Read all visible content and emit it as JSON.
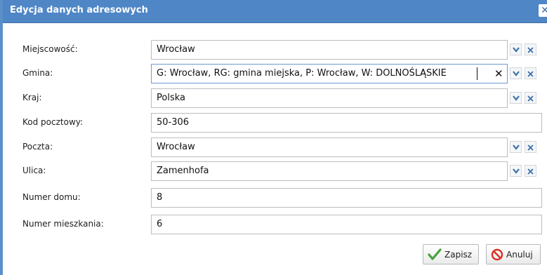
{
  "dialog": {
    "title": "Edycja danych adresowych"
  },
  "fields": {
    "miejscowosc": {
      "label": "Miejscowość:",
      "value": "Wrocław"
    },
    "gmina": {
      "label": "Gmina:",
      "value": "G: Wrocław, RG: gmina miejska, P: Wrocław, W: DOLNOŚLĄSKIE"
    },
    "kraj": {
      "label": "Kraj:",
      "value": "Polska"
    },
    "kod": {
      "label": "Kod pocztowy:",
      "value": "50-306"
    },
    "poczta": {
      "label": "Poczta:",
      "value": "Wrocław"
    },
    "ulica": {
      "label": "Ulica:",
      "value": "Zamenhofa"
    },
    "numer_domu": {
      "label": "Numer domu:",
      "value": "8"
    },
    "numer_mieszkania": {
      "label": "Numer mieszkania:",
      "value": "6"
    }
  },
  "buttons": {
    "save": "Zapisz",
    "cancel": "Anuluj"
  },
  "colors": {
    "titlebar": "#4f86c6",
    "accent": "#3d6fa8",
    "save_icon": "#45a33a",
    "cancel_icon": "#d93025"
  }
}
